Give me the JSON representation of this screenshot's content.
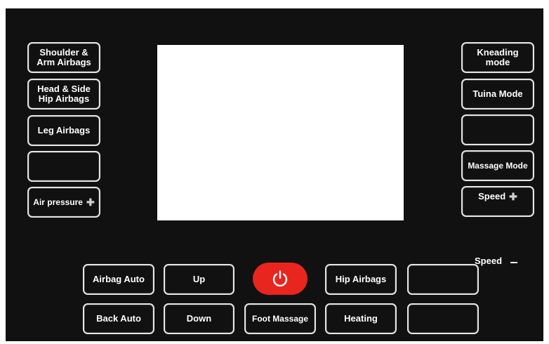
{
  "left_column": {
    "shoulder_arm_airbags": "Shoulder &\nArm Airbags",
    "head_side_hip_airbags": "Head & Side\nHip Airbags",
    "leg_airbags": "Leg Airbags",
    "blank_left": "",
    "air_pressure": "Air pressure"
  },
  "right_column": {
    "kneading_mode": "Kneading\nmode",
    "tuina_mode": "Tuina Mode",
    "blank_right": "",
    "massage_mode": "Massage Mode",
    "speed_up": "Speed"
  },
  "speed_down": "Speed",
  "bottom_row_1": {
    "airbag_auto": "Airbag Auto",
    "up": "Up",
    "hip_airbags": "Hip  Airbags",
    "blank": ""
  },
  "bottom_row_2": {
    "back_auto": "Back Auto",
    "down": "Down",
    "foot_massage": "Foot Massage",
    "heating": "Heating",
    "blank": ""
  },
  "colors": {
    "panel": "#111111",
    "power": "#e8251f",
    "button_border": "#e6e6e6",
    "text": "#ffffff"
  },
  "icons": {
    "power": "power-icon",
    "plus": "plus-icon",
    "minus": "minus-icon"
  }
}
